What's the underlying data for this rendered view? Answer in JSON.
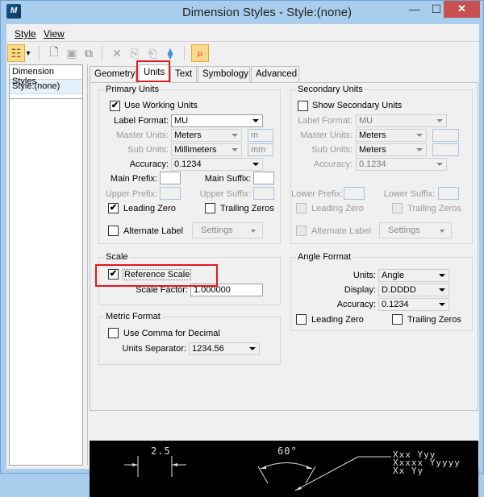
{
  "window": {
    "title": "Dimension Styles -  Style:(none)",
    "controls": {
      "minimize": "—",
      "maximize": "☐",
      "close": "✕"
    }
  },
  "menu": [
    {
      "label": "Style",
      "accel": "S"
    },
    {
      "label": "View",
      "accel": "V"
    }
  ],
  "toolbar": {
    "buttons": [
      {
        "icon": "tree-view-icon",
        "glyph": "☷"
      },
      {
        "icon": "dropdown-arrow-icon",
        "glyph": "▾"
      },
      {
        "icon": "new-style-icon",
        "glyph": "🗋"
      },
      {
        "icon": "save-icon",
        "glyph": "▣"
      },
      {
        "icon": "copy-icon",
        "glyph": "⧉"
      },
      {
        "icon": "delete-icon",
        "glyph": "✕"
      },
      {
        "icon": "import-icon",
        "glyph": "⎘"
      },
      {
        "icon": "export-icon",
        "glyph": "⎗"
      },
      {
        "icon": "layers-icon",
        "glyph": "⧫"
      },
      {
        "icon": "find-dimension-icon",
        "glyph": "⌕"
      }
    ]
  },
  "sidebar": {
    "header": "Dimension Styles",
    "items": [
      {
        "label": "Style:(none)",
        "selected": true
      }
    ]
  },
  "tabs": [
    {
      "label": "Geometry",
      "selected": false
    },
    {
      "label": "Units",
      "selected": true
    },
    {
      "label": "Text",
      "selected": false
    },
    {
      "label": "Symbology",
      "selected": false
    },
    {
      "label": "Advanced",
      "selected": false
    }
  ],
  "primary_units": {
    "title": "Primary Units",
    "use_working_units": {
      "label": "Use Working Units",
      "checked": true
    },
    "label_format": {
      "label": "Label Format:",
      "value": "MU"
    },
    "master_units": {
      "label": "Master Units:",
      "value": "Meters",
      "abbrev": "m"
    },
    "sub_units": {
      "label": "Sub Units:",
      "value": "Millimeters",
      "abbrev": "mm"
    },
    "accuracy": {
      "label": "Accuracy:",
      "value": "0.1234"
    },
    "main_prefix": {
      "label": "Main Prefix:",
      "value": ""
    },
    "main_suffix": {
      "label": "Main Suffix:",
      "value": ""
    },
    "upper_prefix": {
      "label": "Upper Prefix:",
      "value": ""
    },
    "upper_suffix": {
      "label": "Upper Suffix:",
      "value": ""
    },
    "leading_zero": {
      "label": "Leading Zero",
      "checked": true
    },
    "trailing_zeros": {
      "label": "Trailing Zeros",
      "checked": false
    },
    "alternate_label": {
      "label": "Alternate Label",
      "checked": false
    },
    "settings": {
      "label": "Settings"
    }
  },
  "secondary_units": {
    "title": "Secondary Units",
    "show_secondary_units": {
      "label": "Show Secondary Units",
      "checked": false
    },
    "label_format": {
      "label": "Label Format:",
      "value": "MU"
    },
    "master_units": {
      "label": "Master Units:",
      "value": "Meters",
      "abbrev": ""
    },
    "sub_units": {
      "label": "Sub Units:",
      "value": "Meters",
      "abbrev": ""
    },
    "accuracy": {
      "label": "Accuracy:",
      "value": "0.1234"
    },
    "lower_prefix": {
      "label": "Lower Prefix:",
      "value": ""
    },
    "lower_suffix": {
      "label": "Lower Suffix:",
      "value": ""
    },
    "leading_zero": {
      "label": "Leading Zero",
      "checked": false
    },
    "trailing_zeros": {
      "label": "Trailing Zeros",
      "checked": false
    },
    "alternate_label": {
      "label": "Alternate Label",
      "checked": false
    },
    "settings": {
      "label": "Settings"
    }
  },
  "scale": {
    "title": "Scale",
    "reference_scale": {
      "label": "Reference Scale",
      "checked": true
    },
    "scale_factor": {
      "label": "Scale Factor:",
      "value": "1.000000"
    }
  },
  "metric_format": {
    "title": "Metric Format",
    "use_comma": {
      "label": "Use Comma for Decimal",
      "checked": false
    },
    "units_separator": {
      "label": "Units Separator:",
      "value": "1234.56"
    }
  },
  "angle_format": {
    "title": "Angle Format",
    "units": {
      "label": "Units:",
      "value": "Angle"
    },
    "display": {
      "label": "Display:",
      "value": "D.DDDD"
    },
    "accuracy": {
      "label": "Accuracy:",
      "value": "0.1234"
    },
    "leading_zero": {
      "label": "Leading Zero",
      "checked": false
    },
    "trailing_zeros": {
      "label": "Trailing Zeros",
      "checked": false
    }
  },
  "preview": {
    "linear_value": "2.5",
    "angular_value": "60°",
    "note_lines": [
      "Xxx Yyy",
      "Xxxxx Yyyyy",
      "Xx Yy"
    ]
  },
  "colors": {
    "highlight": "#e0191f",
    "close_button": "#c75050",
    "titlebar": "#a9cdec",
    "selection": "#e5f1fb"
  }
}
